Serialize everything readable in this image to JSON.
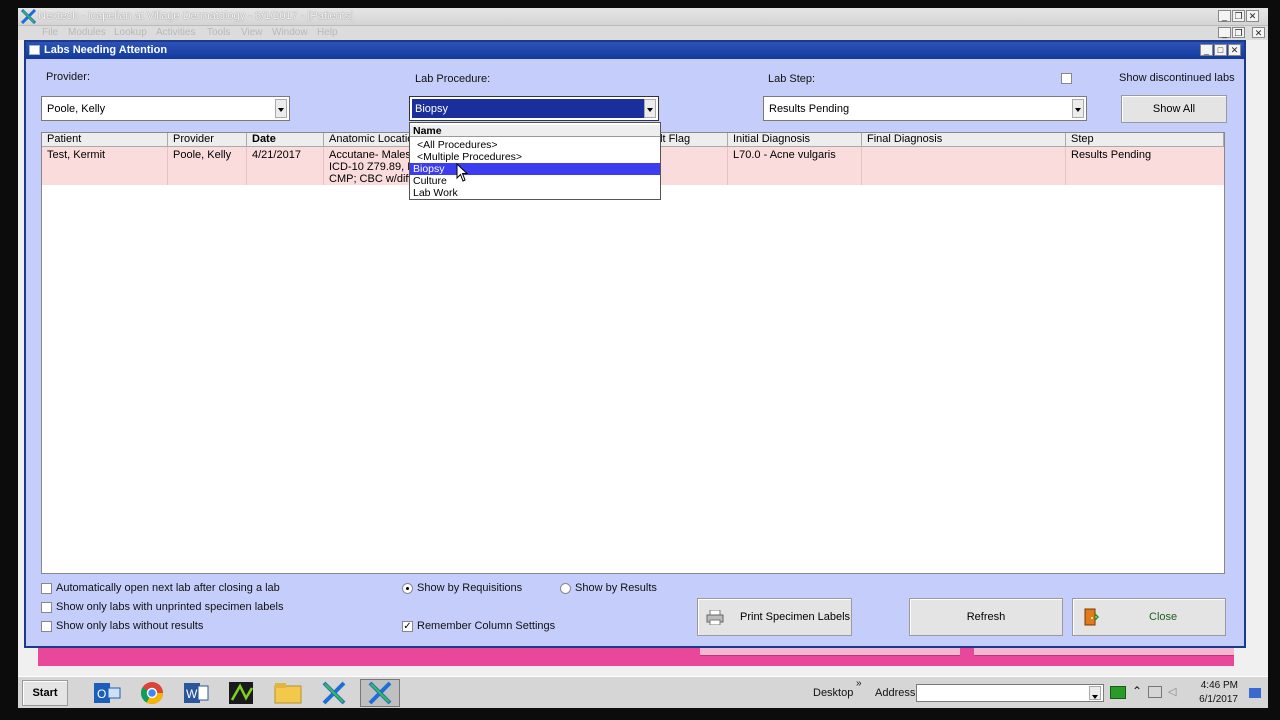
{
  "app": {
    "title": "Nextech - icapellan at Village Dermatology - 6/1/2017 - [Patients]",
    "menu": [
      "File",
      "Modules",
      "Lookup",
      "Activities",
      "Tools",
      "View",
      "Window",
      "Help"
    ]
  },
  "dialog": {
    "title": "Labs Needing Attention",
    "provider_label": "Provider:",
    "provider_value": "Poole, Kelly",
    "lab_procedure_label": "Lab Procedure:",
    "lab_procedure_value": "Biopsy",
    "lab_step_label": "Lab Step:",
    "lab_step_value": "Results Pending",
    "show_discontinued_label": "Show discontinued labs",
    "show_all_label": "Show All"
  },
  "grid": {
    "columns": [
      "Patient",
      "Provider",
      "Date",
      "Anatomic Location",
      "ult Flag",
      "Initial Diagnosis",
      "Final Diagnosis",
      "Step"
    ],
    "rows": [
      {
        "patient": "Test, Kermit",
        "provider": "Poole, Kelly",
        "date": "4/21/2017",
        "anatomic_line1": "Accutane- Males",
        "anatomic_line2": "ICD-10 Z79.89, E",
        "anatomic_line3": "CMP; CBC w/diff",
        "result_flag": "",
        "initial_diagnosis": "L70.0 - Acne vulgaris",
        "final_diagnosis": "",
        "step": "Results Pending"
      }
    ]
  },
  "dropdown": {
    "header": "Name",
    "items": [
      "<All Procedures>",
      "<Multiple Procedures>",
      "Biopsy",
      "Culture",
      "Lab Work"
    ],
    "selected_index": 2
  },
  "options": {
    "auto_open_label": "Automatically open next lab after closing a lab",
    "unprinted_label": "Show only labs with unprinted specimen labels",
    "without_results_label": "Show only labs without results",
    "by_requisitions_label": "Show by Requisitions",
    "by_results_label": "Show by Results",
    "remember_columns_label": "Remember Column Settings",
    "remember_columns_checked": true,
    "show_by": "requisitions"
  },
  "buttons": {
    "print_labels": "Print Specimen Labels",
    "refresh": "Refresh",
    "close": "Close"
  },
  "taskbar": {
    "start_label": "Start",
    "desktop_label": "Desktop",
    "address_label": "Address",
    "time": "4:46 PM",
    "date": "6/1/2017"
  },
  "colors": {
    "dialog_bg": "#c5cefb",
    "row_highlight": "#fbdcdc",
    "selected_item": "#3c3cf0",
    "pink_bar": "#e8479a"
  }
}
